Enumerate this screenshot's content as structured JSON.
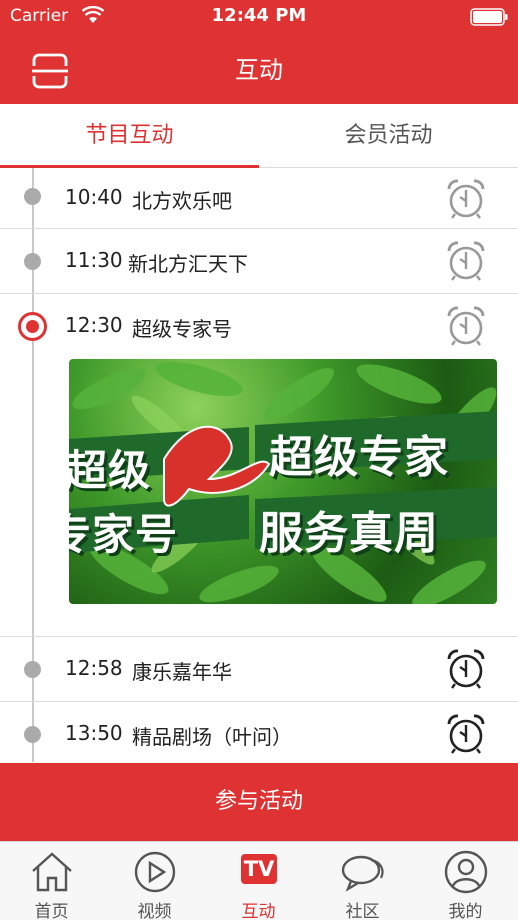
{
  "status_bar": {
    "carrier": "Carrier",
    "time": "12:44 PM"
  },
  "header": {
    "title": "互动"
  },
  "tabs": [
    {
      "label": "节目互动",
      "active": true
    },
    {
      "label": "会员活动",
      "active": false
    }
  ],
  "schedule": [
    {
      "time": "10:40",
      "name": "北方欢乐吧",
      "active": false
    },
    {
      "time": "11:30",
      "name": "新北方汇天下",
      "active": false
    },
    {
      "time": "12:30",
      "name": "超级专家号",
      "active": true
    },
    {
      "time": "12:58",
      "name": "康乐嘉年华",
      "active": false
    },
    {
      "time": "13:50",
      "name": "精品剧场（叶问）",
      "active": false
    }
  ],
  "banner": {
    "text_left_top": "超级",
    "text_left_bottom": "专家号",
    "text_right_top": "超级专家",
    "text_right_bottom": "服务真周"
  },
  "cta": {
    "label": "参与活动"
  },
  "tabbar": [
    {
      "label": "首页",
      "icon": "home-icon"
    },
    {
      "label": "视频",
      "icon": "play-icon"
    },
    {
      "label": "互动",
      "icon": "tv-icon",
      "badge": "TV",
      "active": true
    },
    {
      "label": "社区",
      "icon": "chat-icon"
    },
    {
      "label": "我的",
      "icon": "user-icon"
    }
  ],
  "colors": {
    "accent": "#de3332",
    "timeline": "#c9c9c9"
  }
}
